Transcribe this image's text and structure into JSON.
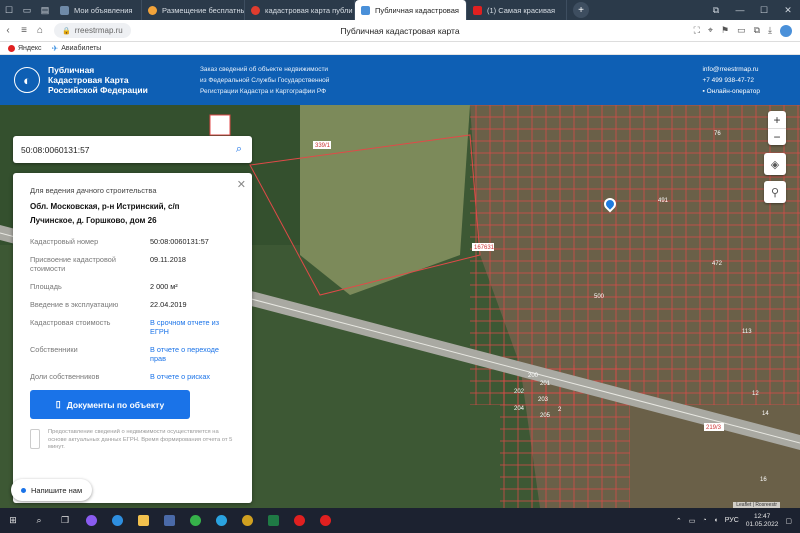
{
  "browser": {
    "tabs": [
      {
        "label": "Мои объявления",
        "color": "#6f8aa8",
        "active": false
      },
      {
        "label": "Размещение бесплатных",
        "color": "#f2a33a",
        "active": false
      },
      {
        "label": "кадастровая карта публи",
        "color": "#e03c2e",
        "active": false
      },
      {
        "label": "Публичная кадастровая",
        "color": "#4a90d9",
        "active": true
      },
      {
        "label": "(1) Самая красивая",
        "color": "#e02020",
        "active": false
      }
    ],
    "url": "rreestrmap.ru",
    "page_title": "Публичная кадастровая карта",
    "bookmarks": [
      {
        "label": "Яндекс",
        "color": "#e02020"
      },
      {
        "label": "Авиабилеты",
        "color": "#3b8fe0"
      }
    ]
  },
  "site_header": {
    "brand_line1": "Публичная",
    "brand_line2": "Кадастровая Карта",
    "brand_line3": "Российской Федерации",
    "desc_line1": "Заказ сведений об объекте недвижимости",
    "desc_line2": "из Федеральной Службы Государственной",
    "desc_line3": "Регистрации Кадастра и Картографии РФ",
    "email": "info@rreestrmap.ru",
    "phone": "+7 499 938-47-72",
    "operator": "Онлайн-оператор"
  },
  "search": {
    "value": "50:08:0060131:57"
  },
  "map": {
    "zoom_in": "+",
    "zoom_out": "−",
    "labels": [
      "339/1",
      "167631",
      "219/3",
      "491",
      "500",
      "472",
      "76",
      "113",
      "200",
      "201",
      "202",
      "203",
      "204",
      "205",
      "12",
      "14",
      "16",
      "2"
    ],
    "copyright": "Leaflet | Rosreestr"
  },
  "panel": {
    "purpose": "Для ведения дачного строительства",
    "address_line1": "Обл. Московская, р-н Истринский, с/п",
    "address_line2": "Лучинское, д. Горшково, дом 26",
    "rows": [
      {
        "label": "Кадастровый номер",
        "value": "50:08:0060131:57",
        "link": false
      },
      {
        "label": "Присвоение кадастровой стоимости",
        "value": "09.11.2018",
        "link": false
      },
      {
        "label": "Площадь",
        "value": "2 000 м²",
        "link": false
      },
      {
        "label": "Введение в эксплуатацию",
        "value": "22.04.2019",
        "link": false
      },
      {
        "label": "Кадастровая стоимость",
        "value": "В срочном отчете из ЕГРН",
        "link": true
      },
      {
        "label": "Собственники",
        "value": "В отчете о переходе прав",
        "link": true
      },
      {
        "label": "Доли собственников",
        "value": "В отчете о рисках",
        "link": true
      }
    ],
    "button_label": "Документы по объекту",
    "disclaimer": "Предоставление сведений о недвижимости осуществляется на основе актуальных данных ЕГРН. Время формирования отчета от 5 минут."
  },
  "chat": {
    "label": "Напишите нам"
  },
  "taskbar": {
    "lang": "РУС",
    "time": "12:47",
    "date": "01.05.2022"
  }
}
